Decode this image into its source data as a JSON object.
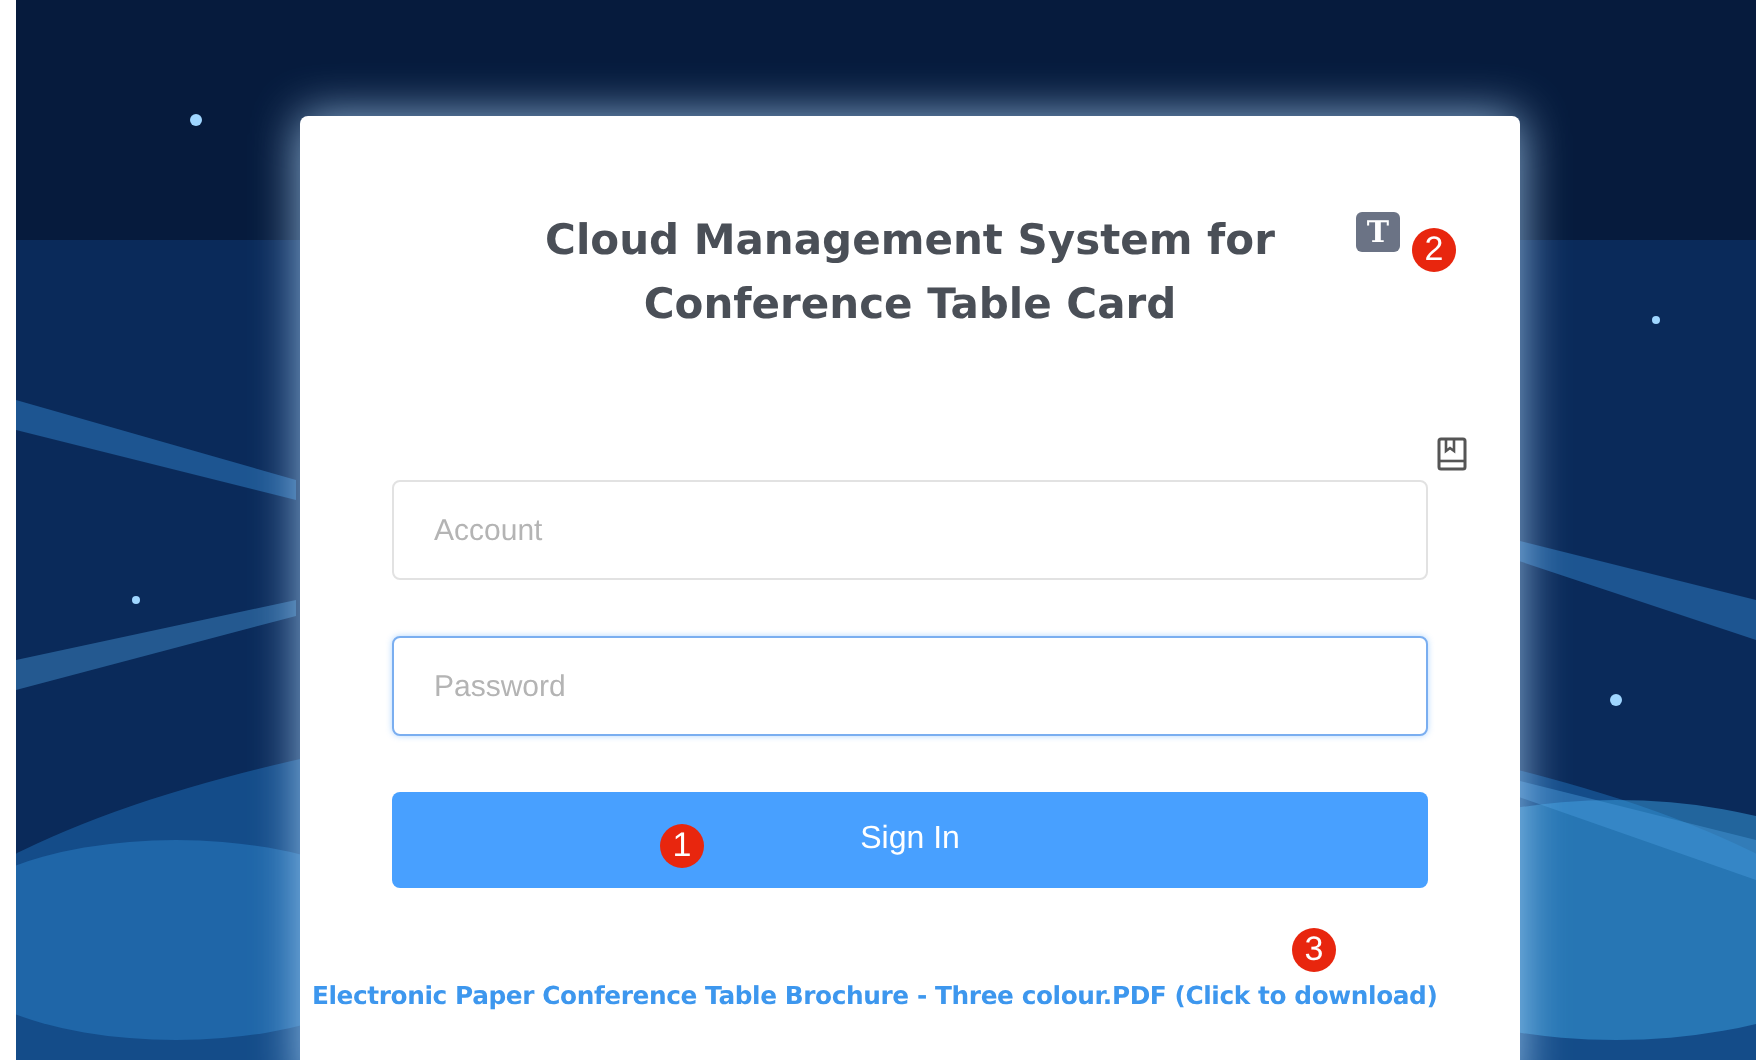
{
  "login_card": {
    "title": "Cloud Management System for Conference Table Card",
    "font_toggle": "T",
    "account": {
      "placeholder": "Account"
    },
    "password": {
      "placeholder": "Password",
      "focused": true
    },
    "sign_in_button": "Sign In",
    "brochure_link": "Electronic Paper Conference Table Brochure - Three colour.PDF (Click to download)"
  },
  "annotations": [
    {
      "label": "1"
    },
    {
      "label": "2"
    },
    {
      "label": "3"
    }
  ]
}
